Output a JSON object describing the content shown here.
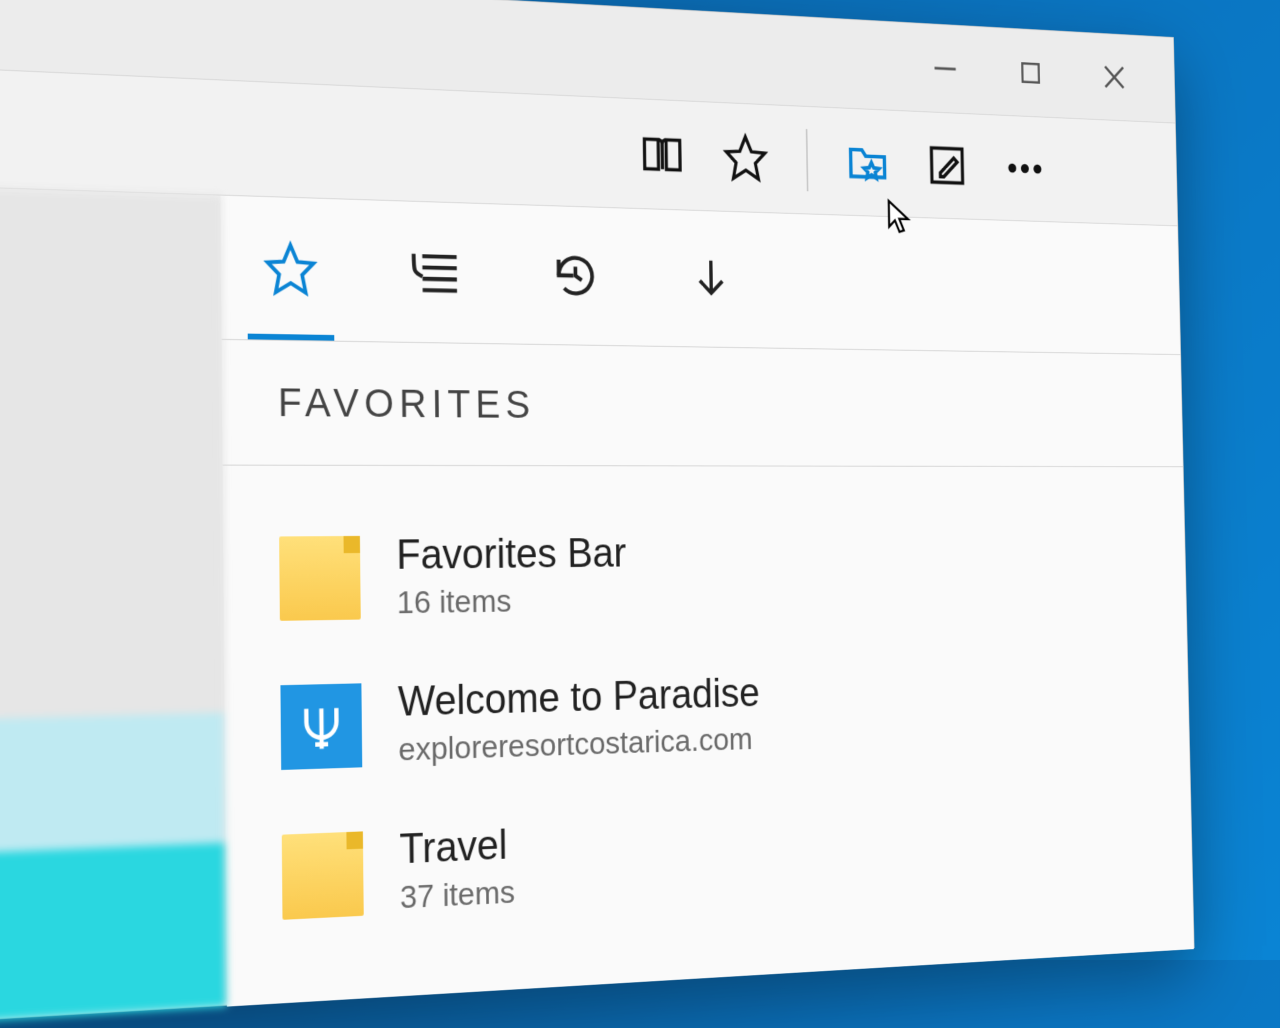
{
  "window_controls": {
    "minimize": "−",
    "maximize": "□",
    "close": "×"
  },
  "toolbar": {
    "reading_list": "reading-list",
    "star": "add-favorite",
    "new_folder": "favorites-folder",
    "edit": "make-note",
    "more": "more"
  },
  "hub": {
    "tabs": [
      "favorites",
      "reading-list",
      "history",
      "downloads"
    ],
    "header": "FAVORITES",
    "items": [
      {
        "kind": "folder",
        "title": "Favorites Bar",
        "subtitle": "16 items"
      },
      {
        "kind": "site",
        "title": "Welcome to Paradise",
        "subtitle": "exploreresortcostarica.com"
      },
      {
        "kind": "folder",
        "title": "Travel",
        "subtitle": "37 items"
      }
    ]
  }
}
